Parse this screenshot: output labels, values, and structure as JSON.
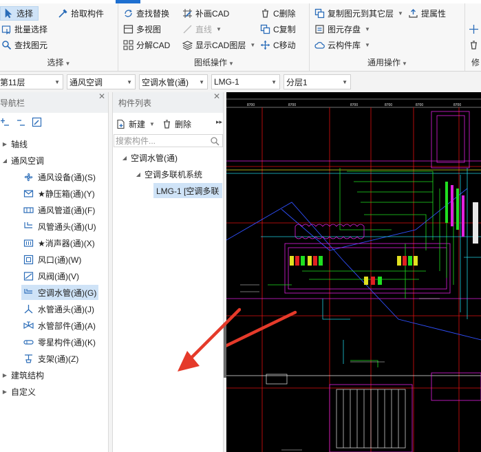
{
  "ribbon": {
    "select_group": {
      "label": "选择",
      "select": "选择",
      "pick": "拾取构件",
      "batch": "批量选择",
      "find": "查找图元"
    },
    "drawing_group": {
      "label": "图纸操作",
      "find_replace": "查找替换",
      "supplement_cad": "补画CAD",
      "delete": "C删除",
      "multi_view": "多视图",
      "line": "直线",
      "copy": "C复制",
      "decompose": "分解CAD",
      "show_layers": "显示CAD图层",
      "move": "C移动"
    },
    "common_group": {
      "label": "通用操作",
      "copy_to_floor": "复制图元到其它层",
      "extract_attr": "提属性",
      "element_save": "图元存盘",
      "cloud_lib": "云构件库"
    },
    "cut_group": {
      "label": "修"
    }
  },
  "toolbar": {
    "floor": "第11层",
    "discipline": "通风空调",
    "type": "空调水管(通)",
    "component": "LMG-1",
    "layer": "分层1"
  },
  "nav": {
    "title": "导航栏",
    "tree": [
      {
        "label": "轴线",
        "expanded": false
      },
      {
        "label": "通风空调",
        "expanded": true
      },
      {
        "label": "建筑结构",
        "expanded": false
      },
      {
        "label": "自定义",
        "expanded": false
      }
    ],
    "items": [
      {
        "label": "通风设备(通)(S)",
        "icon": "fan-icon"
      },
      {
        "label": "★静压箱(通)(Y)",
        "icon": "plenum-box-icon"
      },
      {
        "label": "通风管道(通)(F)",
        "icon": "duct-icon"
      },
      {
        "label": "风管通头(通)(U)",
        "icon": "duct-fitting-icon"
      },
      {
        "label": "★消声器(通)(X)",
        "icon": "silencer-icon"
      },
      {
        "label": "风口(通)(W)",
        "icon": "air-outlet-icon"
      },
      {
        "label": "风阀(通)(V)",
        "icon": "damper-icon"
      },
      {
        "label": "空调水管(通)(G)",
        "icon": "water-pipe-icon"
      },
      {
        "label": "水管通头(通)(J)",
        "icon": "pipe-fitting-icon"
      },
      {
        "label": "水管部件(通)(A)",
        "icon": "pipe-valve-icon"
      },
      {
        "label": "零星构件(通)(K)",
        "icon": "misc-component-icon"
      },
      {
        "label": "支架(通)(Z)",
        "icon": "support-icon"
      }
    ]
  },
  "component_list": {
    "title": "构件列表",
    "new_label": "新建",
    "delete_label": "删除",
    "search_placeholder": "搜索构件...",
    "tree": {
      "root": "空调水管(通)",
      "child": "空调多联机系统",
      "leaf": "LMG-1 [空调多联"
    }
  },
  "cad": {
    "dimension_labels": [
      "8700",
      "8700",
      "8700",
      "8700",
      "8700",
      "8700"
    ],
    "colors": {
      "grid": "#e01010",
      "magenta": "#e020e0",
      "green": "#20e020",
      "cyan": "#20d0e0",
      "yellow": "#e0e020",
      "white": "#e8e8e8",
      "blue": "#3050ff",
      "arrow": "#e53a2a"
    }
  }
}
